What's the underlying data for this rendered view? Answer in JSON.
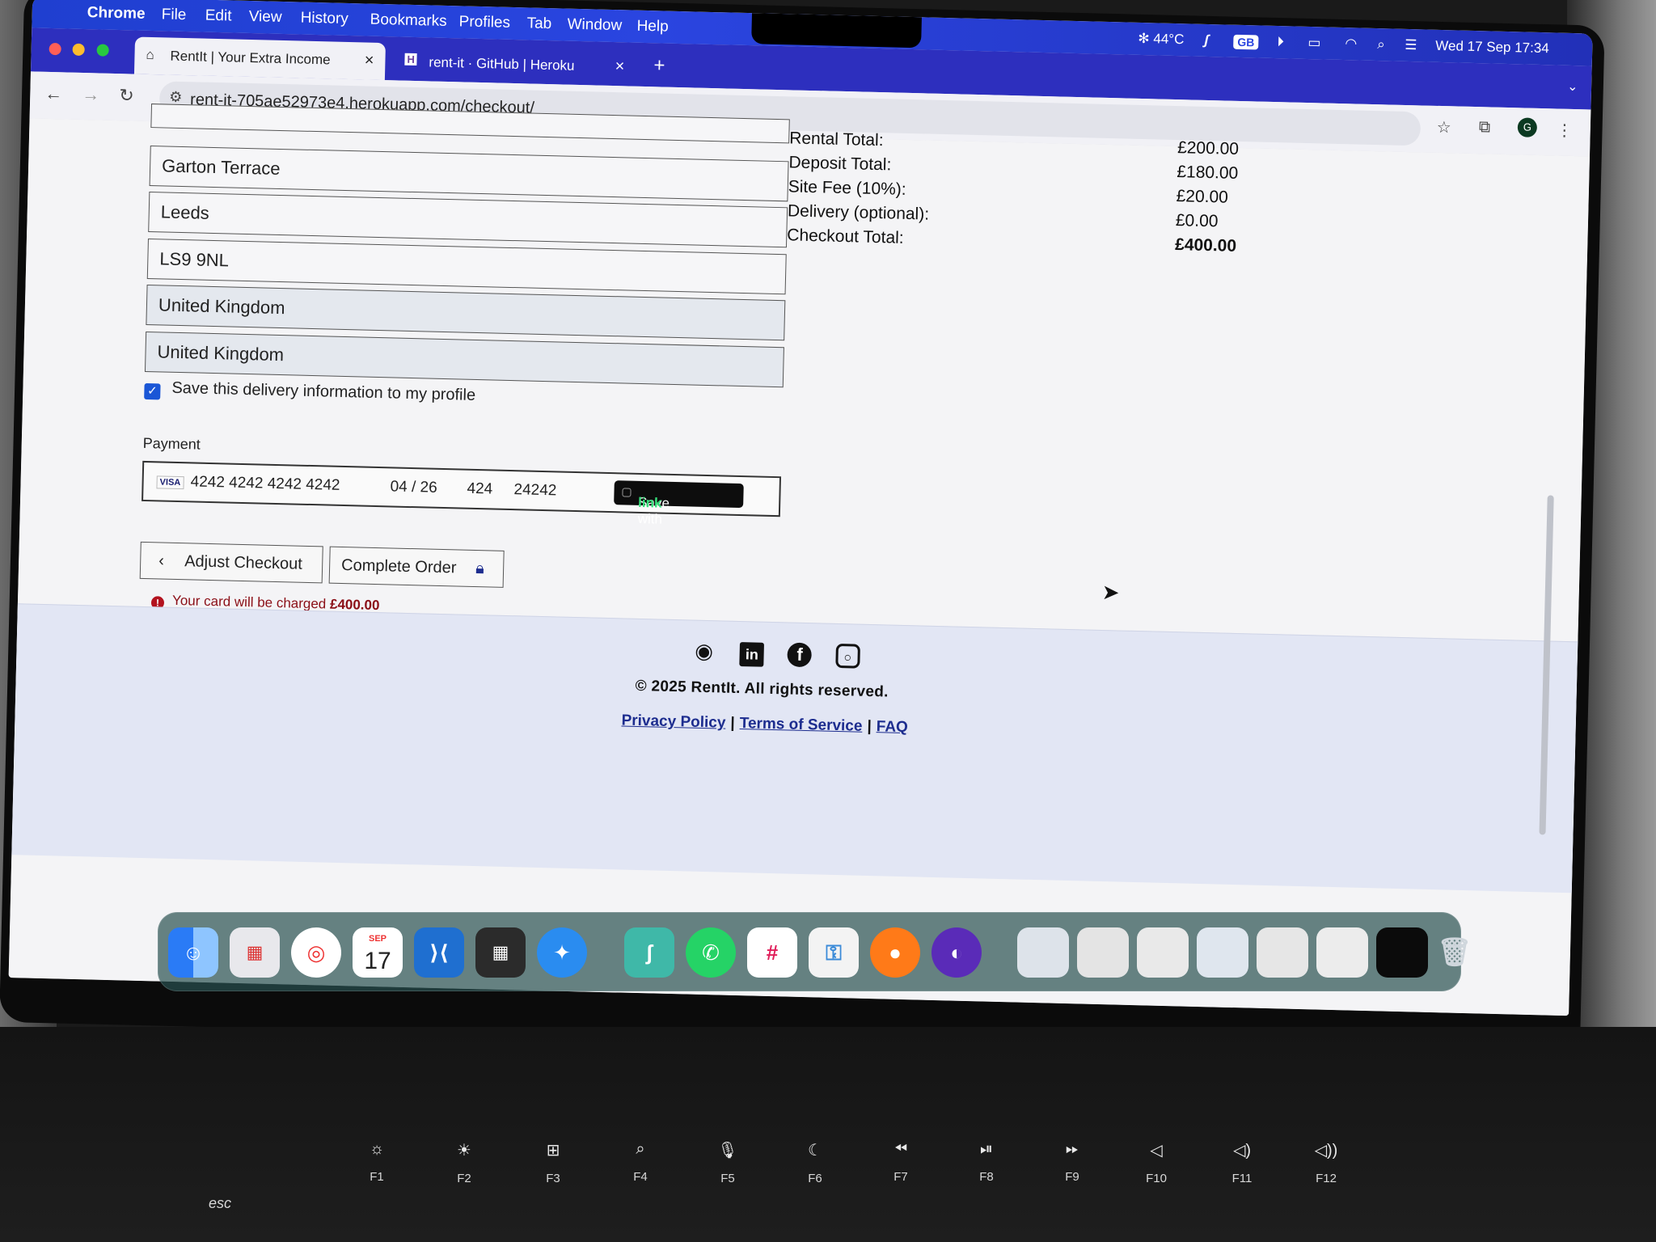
{
  "menubar": {
    "app": "Chrome",
    "items": [
      "File",
      "Edit",
      "View",
      "History",
      "Bookmarks",
      "Profiles",
      "Tab",
      "Window",
      "Help"
    ],
    "temperature": "44°C",
    "keyboard_layout": "GB",
    "datetime": "Wed 17 Sep  17:34"
  },
  "tabs": [
    {
      "title": "RentIt | Your Extra Income",
      "active": true
    },
    {
      "title": "rent-it · GitHub | Heroku",
      "active": false
    }
  ],
  "toolbar": {
    "url": "rent-it-705ae52973e4.herokuapp.com/checkout/",
    "profile_initial": "G"
  },
  "form": {
    "street": "Garton Terrace",
    "city": "Leeds",
    "postcode": "LS9 9NL",
    "county": "United Kingdom",
    "country": "United Kingdom",
    "save_info_label": "Save this delivery information to my profile",
    "payment_label": "Payment",
    "card_brand": "VISA",
    "card_number": "4242 4242 4242 4242",
    "card_expiry": "04 / 26",
    "card_cvc": "424",
    "card_postcode": "24242",
    "save_with": "Save with",
    "link_brand": "link"
  },
  "buttons": {
    "adjust": "Adjust Checkout",
    "complete": "Complete Order"
  },
  "charge_notice": {
    "prefix": "Your card will be charged",
    "amount": "£400.00"
  },
  "summary": {
    "rows": [
      {
        "label": "Rental Total:",
        "value": "£200.00"
      },
      {
        "label": "Deposit Total:",
        "value": "£180.00"
      },
      {
        "label": "Site Fee (10%):",
        "value": "£20.00"
      },
      {
        "label": "Delivery (optional):",
        "value": "£0.00"
      },
      {
        "label": "Checkout Total:",
        "value": "£400.00"
      }
    ]
  },
  "footer": {
    "copyright": "© 2025 RentIt. All rights reserved.",
    "privacy": "Privacy Policy",
    "terms": "Terms of Service",
    "faq": "FAQ",
    "separator": "|"
  },
  "dock": {
    "calendar_month": "SEP",
    "calendar_day": "17"
  },
  "keyboard": {
    "esc": "esc",
    "fkeys": [
      "F1",
      "F2",
      "F3",
      "F4",
      "F5",
      "F6",
      "F7",
      "F8",
      "F9",
      "F10",
      "F11",
      "F12"
    ]
  },
  "colors": {
    "menubar_blue": "#2a45e0",
    "checkbox_blue": "#1a56d6",
    "error_red": "#8b0f17",
    "link_navy": "#1d2d8f",
    "link_green": "#35e07a"
  }
}
